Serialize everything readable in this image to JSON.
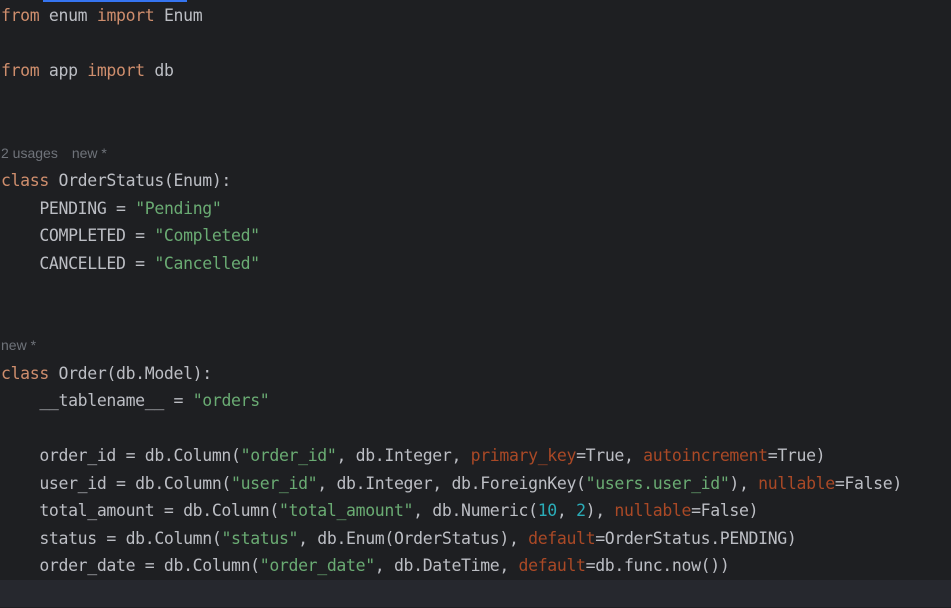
{
  "theme": {
    "background": "#1e1f22",
    "current_line": "#26282e",
    "tab_accent": "#3574f0",
    "keyword": "#cf8e6d",
    "string": "#6aab73",
    "number": "#2aacb8",
    "named_argument": "#aa4926",
    "text": "#bcbec4",
    "inlay_hint": "#6f737a"
  },
  "code": {
    "lines": [
      {
        "tokens": [
          [
            "from",
            "kw"
          ],
          [
            " enum ",
            "tx"
          ],
          [
            "import",
            "kw"
          ],
          [
            " Enum",
            "tx"
          ]
        ]
      },
      {
        "tokens": []
      },
      {
        "tokens": [
          [
            "from",
            "kw"
          ],
          [
            " app ",
            "tx"
          ],
          [
            "import",
            "kw"
          ],
          [
            " db",
            "tx"
          ]
        ]
      },
      {
        "tokens": []
      },
      {
        "tokens": []
      },
      {
        "inlay": [
          "2 usages",
          "new *"
        ]
      },
      {
        "tokens": [
          [
            "class",
            "kw"
          ],
          [
            " OrderStatus(Enum):",
            "tx"
          ]
        ]
      },
      {
        "tokens": [
          [
            "    PENDING = ",
            "tx"
          ],
          [
            "\"Pending\"",
            "str"
          ]
        ]
      },
      {
        "tokens": [
          [
            "    COMPLETED = ",
            "tx"
          ],
          [
            "\"Completed\"",
            "str"
          ]
        ]
      },
      {
        "tokens": [
          [
            "    CANCELLED = ",
            "tx"
          ],
          [
            "\"Cancelled\"",
            "str"
          ]
        ]
      },
      {
        "tokens": []
      },
      {
        "tokens": []
      },
      {
        "inlay": [
          "new *"
        ]
      },
      {
        "tokens": [
          [
            "class",
            "kw"
          ],
          [
            " Order(db.Model):",
            "tx"
          ]
        ]
      },
      {
        "tokens": [
          [
            "    __tablename__ = ",
            "tx"
          ],
          [
            "\"orders\"",
            "str"
          ]
        ]
      },
      {
        "tokens": []
      },
      {
        "tokens": [
          [
            "    order_id = db.Column(",
            "tx"
          ],
          [
            "\"order_id\"",
            "str"
          ],
          [
            ", db.Integer, ",
            "tx"
          ],
          [
            "primary_key",
            "arg"
          ],
          [
            "=True, ",
            "tx"
          ],
          [
            "autoincrement",
            "arg"
          ],
          [
            "=True)",
            "tx"
          ]
        ]
      },
      {
        "tokens": [
          [
            "    user_id = db.Column(",
            "tx"
          ],
          [
            "\"user_id\"",
            "str"
          ],
          [
            ", db.Integer, db.ForeignKey(",
            "tx"
          ],
          [
            "\"users.user_id\"",
            "str"
          ],
          [
            "), ",
            "tx"
          ],
          [
            "nullable",
            "arg"
          ],
          [
            "=False)",
            "tx"
          ]
        ]
      },
      {
        "tokens": [
          [
            "    total_amount = db.Column(",
            "tx"
          ],
          [
            "\"total_amount\"",
            "str"
          ],
          [
            ", db.Numeric(",
            "tx"
          ],
          [
            "10",
            "num"
          ],
          [
            ", ",
            "tx"
          ],
          [
            "2",
            "num"
          ],
          [
            "), ",
            "tx"
          ],
          [
            "nullable",
            "arg"
          ],
          [
            "=False)",
            "tx"
          ]
        ]
      },
      {
        "tokens": [
          [
            "    status = db.Column(",
            "tx"
          ],
          [
            "\"status\"",
            "str"
          ],
          [
            ", db.Enum(OrderStatus), ",
            "tx"
          ],
          [
            "default",
            "arg"
          ],
          [
            "=OrderStatus.PENDING)",
            "tx"
          ]
        ]
      },
      {
        "tokens": [
          [
            "    order_date = db.Column(",
            "tx"
          ],
          [
            "\"order_date\"",
            "str"
          ],
          [
            ", db.DateTime, ",
            "tx"
          ],
          [
            "default",
            "arg"
          ],
          [
            "=db.func.now())",
            "tx"
          ]
        ]
      },
      {
        "tokens": [],
        "current": true
      }
    ]
  }
}
